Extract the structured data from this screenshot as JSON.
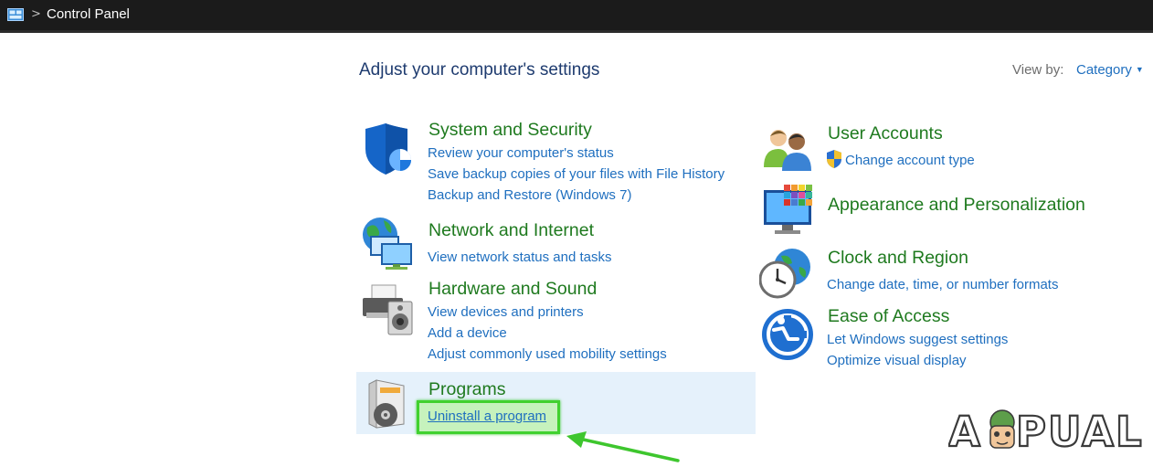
{
  "window": {
    "title": "Control Panel",
    "chevron": ">"
  },
  "page": {
    "heading": "Adjust your computer's settings",
    "view_by_label": "View by:",
    "view_by_value": "Category"
  },
  "categories": [
    {
      "title": "System and Security",
      "icon": "shield-icon",
      "links": [
        "Review your computer's status",
        "Save backup copies of your files with File History",
        "Backup and Restore (Windows 7)"
      ]
    },
    {
      "title": "Network and Internet",
      "icon": "network-globe-icon",
      "links": [
        "View network status and tasks"
      ]
    },
    {
      "title": "Hardware and Sound",
      "icon": "printer-speaker-icon",
      "links": [
        "View devices and printers",
        "Add a device",
        "Adjust commonly used mobility settings"
      ]
    },
    {
      "title": "Programs",
      "icon": "programs-disc-icon",
      "links": [
        "Uninstall a program"
      ],
      "highlighted": true
    },
    {
      "title": "User Accounts",
      "icon": "users-icon",
      "links": [
        "Change account type"
      ],
      "link_icon": "uac-shield-icon"
    },
    {
      "title": "Appearance and Personalization",
      "icon": "monitor-palette-icon",
      "links": []
    },
    {
      "title": "Clock and Region",
      "icon": "clock-globe-icon",
      "links": [
        "Change date, time, or number formats"
      ]
    },
    {
      "title": "Ease of Access",
      "icon": "ease-of-access-icon",
      "links": [
        "Let Windows suggest settings",
        "Optimize visual display"
      ]
    }
  ],
  "annotations": {
    "highlight_color": "#41d12f",
    "arrow_color": "#3ec62e",
    "watermark": "A PUALS"
  },
  "colors": {
    "category_title": "#1f7a1f",
    "link": "#1f6fbf",
    "heading": "#1e3b6f",
    "titlebar_bg": "#1b1b1b",
    "programs_hover_bg": "#e5f1fb"
  }
}
